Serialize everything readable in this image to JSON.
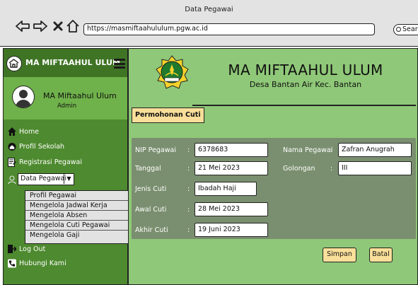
{
  "browser": {
    "window_title": "Data Pegawai",
    "url": "https://masmiftaahululum.pgw.ac.id",
    "search_label": "Search"
  },
  "sidebar": {
    "brand": "MA MIFTAAHUL ULUM",
    "user": {
      "name": "MA Miftaahul Ulum",
      "role": "Admin"
    },
    "items": [
      {
        "label": "Home",
        "icon": "home-icon"
      },
      {
        "label": "Profil Sekolah",
        "icon": "school-icon"
      },
      {
        "label": "Registrasi Pegawai",
        "icon": "register-icon"
      },
      {
        "label": "Data Pegawai",
        "icon": "user-icon"
      },
      {
        "label": "Log Out",
        "icon": "logout-icon"
      },
      {
        "label": "Hubungi Kami",
        "icon": "phone-icon"
      }
    ],
    "dropdown": [
      "Profil Pegawai",
      "Mengelola Jadwal Kerja",
      "Mengelola Absen",
      "Mengelola Cuti Pegawai",
      "Mengelola Gaji"
    ]
  },
  "header": {
    "school_name": "MA MIFTAAHUL ULUM",
    "address": "Desa Bantan Air Kec. Bantan",
    "logo_text": "KEMENAG"
  },
  "page": {
    "title": "Permohonan Cuti"
  },
  "form": {
    "nip": {
      "label": "NIP Pegawai",
      "value": "6378683"
    },
    "tanggal": {
      "label": "Tanggal",
      "value": "21 Mei 2023"
    },
    "jenis_cuti": {
      "label": "Jenis Cuti",
      "value": "Ibadah Haji"
    },
    "awal_cuti": {
      "label": "Awal Cuti",
      "value": "28 Mei 2023"
    },
    "akhir_cuti": {
      "label": "Akhir Cuti",
      "value": "19 Juni 2023"
    },
    "nama": {
      "label": "Nama Pegawai",
      "value": "Zafran Anugrah"
    },
    "golongan": {
      "label": "Golongan",
      "value": "III"
    },
    "colon": ":"
  },
  "actions": {
    "save": "Simpan",
    "cancel": "Batal"
  },
  "colors": {
    "sidebar": "#4e8a2f",
    "main": "#8fc878",
    "card": "#7a8f6f",
    "button": "#f9df9a"
  }
}
